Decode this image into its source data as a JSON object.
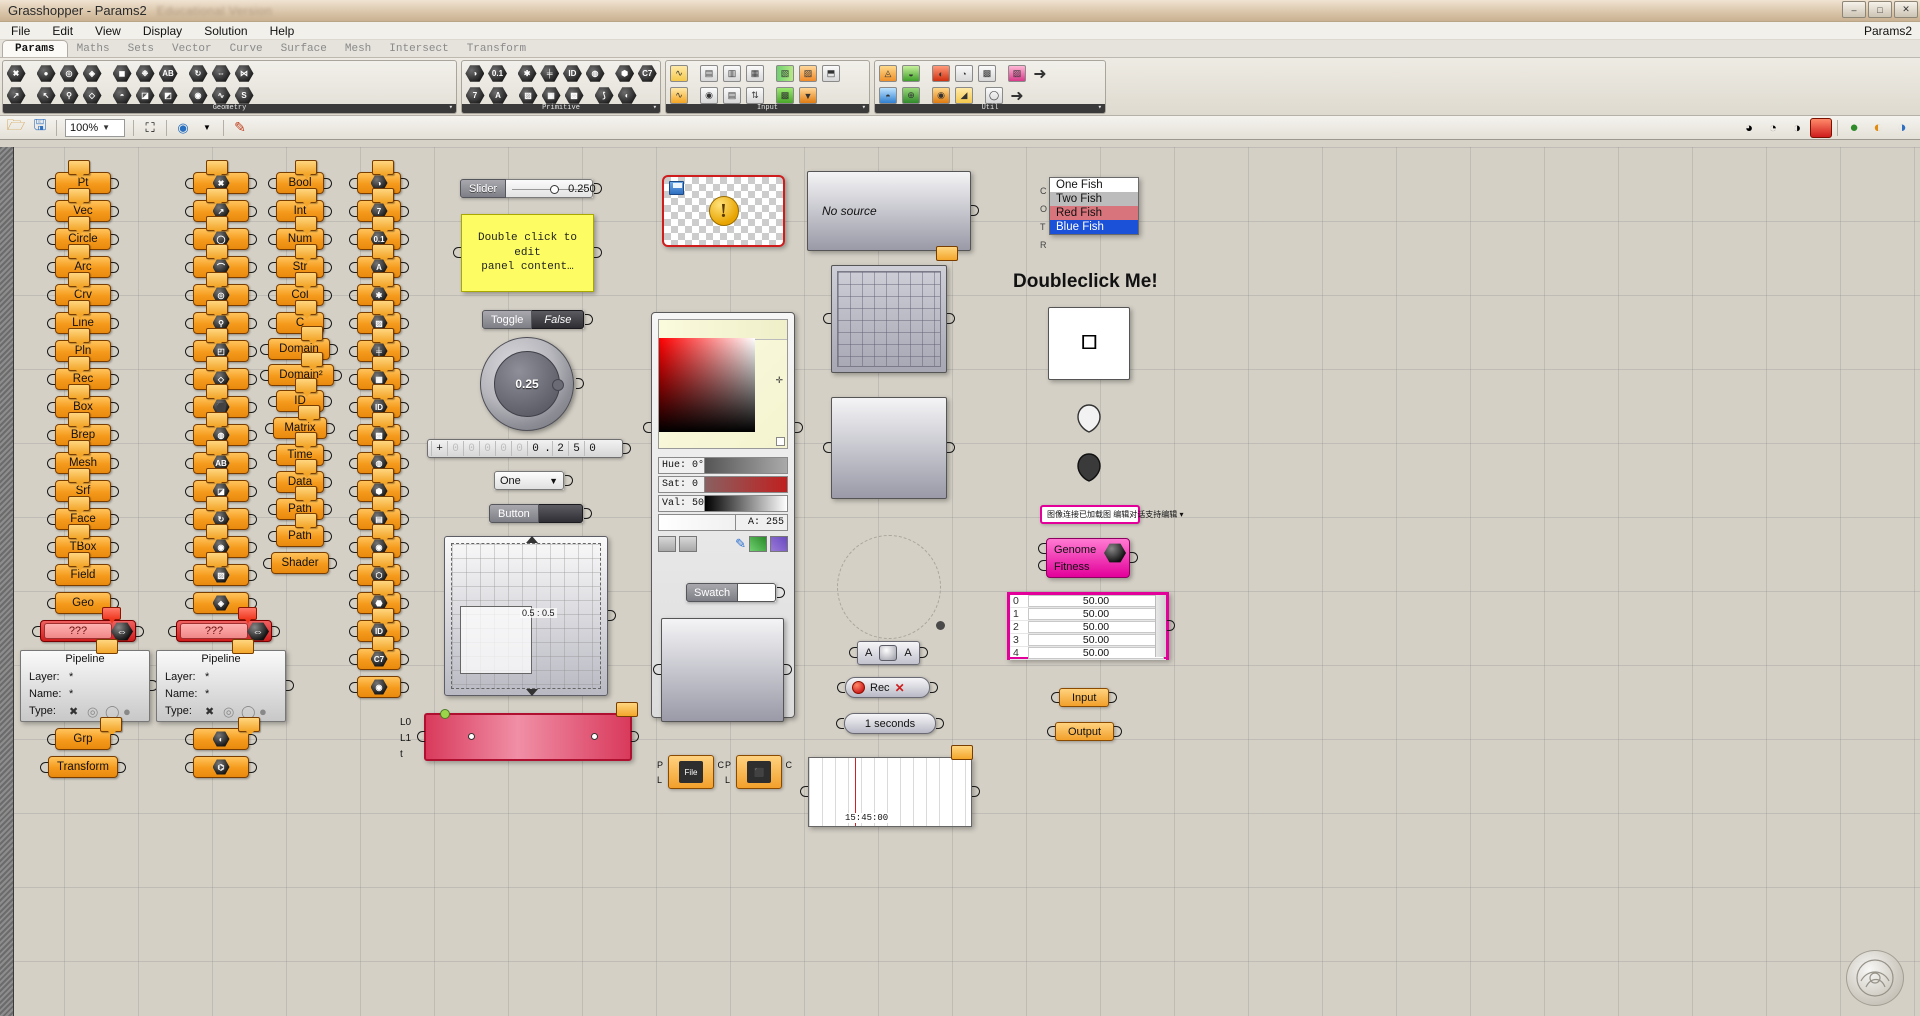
{
  "window": {
    "title": "Grasshopper - Params2",
    "subtitle": "Educational Version",
    "buttons": [
      "–",
      "□",
      "✕"
    ]
  },
  "menu": {
    "items": [
      "File",
      "Edit",
      "View",
      "Display",
      "Solution",
      "Help"
    ],
    "document_label": "Params2"
  },
  "tabs": [
    {
      "label": "Params",
      "active": true
    },
    {
      "label": "Maths",
      "active": false
    },
    {
      "label": "Sets",
      "active": false
    },
    {
      "label": "Vector",
      "active": false
    },
    {
      "label": "Curve",
      "active": false
    },
    {
      "label": "Surface",
      "active": false
    },
    {
      "label": "Mesh",
      "active": false
    },
    {
      "label": "Intersect",
      "active": false
    },
    {
      "label": "Transform",
      "active": false
    }
  ],
  "ribbon": {
    "groups": [
      {
        "name": "Geometry",
        "rows": [
          [
            "✖",
            "●",
            "◎",
            "◈",
            "◼",
            "❉",
            "AB",
            "↻",
            "⇔",
            "⋈"
          ],
          [
            "↗",
            "↖",
            "⚲",
            "◇",
            "◓",
            "◪",
            "◩",
            "◉",
            "∿",
            "S"
          ]
        ]
      },
      {
        "name": "Primitive",
        "rows": [
          [
            "◑",
            "0.1",
            "✱",
            "╪",
            "ID",
            "◍",
            "⬢",
            "C7"
          ],
          [
            "7",
            "A",
            "▨",
            "▦",
            "▩",
            "⟆",
            "◐"
          ]
        ]
      },
      {
        "name": "Input",
        "rows": [
          [
            "∿",
            "▤",
            "▥",
            "▦",
            "▧",
            "▨",
            "⬒",
            "▣"
          ],
          [
            "∿",
            "◉",
            "▤",
            "⇅",
            "▩",
            "▼",
            "◕"
          ]
        ]
      },
      {
        "name": "Util",
        "rows": [
          [
            "◬",
            "◒",
            "◐",
            "◔",
            "▩",
            "▨",
            "▤",
            "➜"
          ],
          [
            "◓",
            "⊕",
            "◉",
            "◢",
            "◍",
            "◯",
            "⌬",
            "➜"
          ]
        ]
      }
    ]
  },
  "toolbar2": {
    "zoom_value": "100%",
    "icons": [
      "open-file",
      "save-file",
      "zoom-level",
      "fit-view",
      "preview-eye",
      "bake"
    ],
    "right_icons": [
      "profiler",
      "cluster",
      "red-sphere",
      "green-sphere",
      "orange-sphere",
      "blue-sphere"
    ]
  },
  "canvas": {
    "column_geometry": [
      "Pt",
      "Vec",
      "Circle",
      "Arc",
      "Crv",
      "Line",
      "Pln",
      "Rec",
      "Box",
      "Brep",
      "Mesh",
      "Srf",
      "Face",
      "TBox",
      "Field",
      "Geo"
    ],
    "column_icons_1": [
      "✖",
      "↗",
      "◯",
      "⌒",
      "◎",
      "⚲",
      "◰",
      "◇",
      "⬛",
      "◍",
      "AB",
      "◪",
      "↻",
      "◉",
      "▨",
      "◈",
      "◐",
      "⌬",
      "◒"
    ],
    "column_primitive": [
      "Bool",
      "Int",
      "Num",
      "Str",
      "Col",
      "C",
      "Domain",
      "Domain²",
      "ID",
      "Matrix",
      "Time",
      "Data",
      "Path",
      "Path",
      "Shader"
    ],
    "column_icons_2": [
      "◑",
      "7",
      "0.1",
      "A",
      "✱",
      "▨",
      "╪",
      "▦",
      "ID",
      "▩",
      "◍",
      "⬢",
      "▤",
      "◉",
      "⬡",
      "⬣",
      "ID",
      "C7",
      "◉"
    ],
    "error_components": [
      {
        "label": "???"
      },
      {
        "label": "???"
      }
    ],
    "pipelines": [
      {
        "title": "Pipeline",
        "layer_label": "Layer:",
        "layer_value": "*",
        "name_label": "Name:",
        "name_value": "*",
        "type_label": "Type:"
      },
      {
        "title": "Pipeline",
        "layer_label": "Layer:",
        "layer_value": "*",
        "name_label": "Name:",
        "name_value": "*",
        "type_label": "Type:"
      }
    ],
    "bottom_params": [
      "Grp",
      "Transform"
    ],
    "slider": {
      "label": "Slider",
      "value": "0.250"
    },
    "panel": {
      "text": "Double click to edit\npanel content…"
    },
    "toggle": {
      "label": "Toggle",
      "value": "False"
    },
    "knob": {
      "value": "0.25"
    },
    "digits": {
      "pale": [
        "0",
        "0",
        "0",
        "0",
        "0"
      ],
      "pre": "0",
      "dot": ".",
      "post": [
        "2",
        "5",
        "0"
      ]
    },
    "valuelist": {
      "selected": "One"
    },
    "button": {
      "label": "Button"
    },
    "pad2d": {
      "value": "0.5 : 0.5"
    },
    "gradient": {
      "stops": [
        "L0",
        "L1",
        "t"
      ]
    },
    "imagebox": {
      "warning": "!"
    },
    "colorpicker": {
      "hue_label": "Hue:",
      "hue_value": "0°",
      "sat_label": "Sat:",
      "sat_value": "0",
      "val_label": "Val:",
      "val_value": "50",
      "alpha_label": "A:",
      "alpha_value": "255"
    },
    "swatch": {
      "label": "Swatch"
    },
    "no_source": {
      "text": "No source"
    },
    "file_pills": [
      {
        "left_top": "P",
        "left_bottom": "L",
        "right": "C",
        "body": "File"
      },
      {
        "left_top": "P",
        "left_bottom": "L",
        "right": "C",
        "body": ""
      }
    ],
    "ab_control": {
      "left": "A",
      "right": "A"
    },
    "rec_control": {
      "label": "Rec"
    },
    "seconds_control": {
      "label": "1 seconds"
    },
    "timeline": {
      "timecode": "15:45:00"
    },
    "fishlist": {
      "shanks": [
        "C",
        "O",
        "T",
        "R"
      ],
      "items": [
        {
          "label": "One Fish",
          "state": "normal"
        },
        {
          "label": "Two Fish",
          "state": "sel-gray"
        },
        {
          "label": "Red Fish",
          "state": "sel-red"
        },
        {
          "label": "Blue Fish",
          "state": "sel-blue"
        }
      ]
    },
    "doubleclick": {
      "label": "Doubleclick Me!"
    },
    "cjk_pill": {
      "text": "图像连接已加载图 编辑对话支持编辑 ▾"
    },
    "genome": {
      "row1": "Genome",
      "row2": "Fitness"
    },
    "datagrid": {
      "rows": [
        {
          "index": "0",
          "value": "50.00"
        },
        {
          "index": "1",
          "value": "50.00"
        },
        {
          "index": "2",
          "value": "50.00"
        },
        {
          "index": "3",
          "value": "50.00"
        },
        {
          "index": "4",
          "value": "50.00"
        }
      ]
    },
    "io_params": [
      {
        "label": "Input"
      },
      {
        "label": "Output"
      }
    ]
  },
  "colors": {
    "param_orange": "#f59a1c",
    "error_red": "#cf1d1d",
    "magenta": "#e3009a",
    "panel_yellow": "#fdfd63",
    "canvas_bg": "#d4d0c6",
    "selected_blue": "#1b50d8"
  }
}
